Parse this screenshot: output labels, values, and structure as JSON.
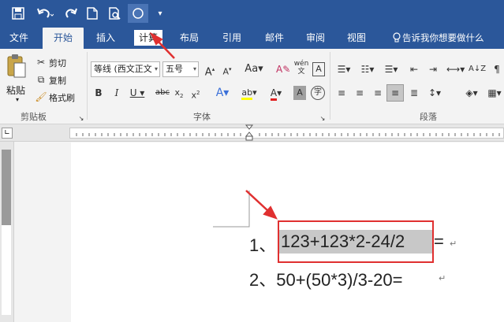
{
  "qat": {
    "items": [
      "save-icon",
      "undo-icon",
      "redo-icon",
      "new-doc-icon",
      "print-preview-icon",
      "circle-shape-icon",
      "customize-qat-icon"
    ]
  },
  "tabs": [
    {
      "label": "文件"
    },
    {
      "label": "开始"
    },
    {
      "label": "插入"
    },
    {
      "label": "计算"
    },
    {
      "label": "布局"
    },
    {
      "label": "引用"
    },
    {
      "label": "邮件"
    },
    {
      "label": "审阅"
    },
    {
      "label": "视图"
    }
  ],
  "tell_me": "告诉我你想要做什么",
  "clipboard": {
    "paste": "粘贴",
    "cut": "剪切",
    "copy": "复制",
    "format_painter": "格式刷",
    "group_label": "剪贴板"
  },
  "font": {
    "font_name": "等线 (西文正文",
    "font_size": "五号",
    "group_label": "字体"
  },
  "paragraph": {
    "group_label": "段落"
  },
  "document": {
    "line1_num": "1、",
    "line1_expr": "123+123*2-24/2",
    "line1_eq": "=",
    "line2": "2、50+(50*3)/3-20=",
    "para_mark": "↵"
  },
  "colors": {
    "ribbon_blue": "#2b579a",
    "highlight_box": "#e03030",
    "selection": "#c8c8c8"
  }
}
